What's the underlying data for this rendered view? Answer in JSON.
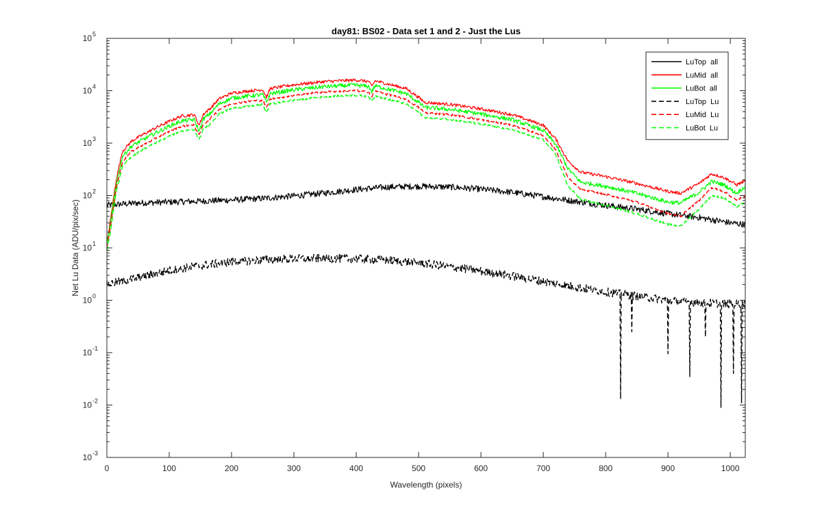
{
  "chart_data": {
    "type": "line",
    "title": "day81: BS02 - Data set 1 and 2 - Just the Lus",
    "xlabel": "Wavelength (pixels)",
    "ylabel": "Net Lu Data (ADU/pix/sec)",
    "xlim": [
      0,
      1024
    ],
    "ylim": [
      0.001,
      100000
    ],
    "yscale": "log",
    "x_ticks": [
      0,
      100,
      200,
      300,
      400,
      500,
      600,
      700,
      800,
      900,
      1000
    ],
    "y_ticks": [
      {
        "value": 0.001,
        "base": "10",
        "exp": "-3"
      },
      {
        "value": 0.01,
        "base": "10",
        "exp": "-2"
      },
      {
        "value": 0.1,
        "base": "10",
        "exp": "-1"
      },
      {
        "value": 1,
        "base": "10",
        "exp": "0"
      },
      {
        "value": 10,
        "base": "10",
        "exp": "1"
      },
      {
        "value": 100,
        "base": "10",
        "exp": "2"
      },
      {
        "value": 1000,
        "base": "10",
        "exp": "3"
      },
      {
        "value": 10000,
        "base": "10",
        "exp": "4"
      },
      {
        "value": 100000,
        "base": "10",
        "exp": "5"
      }
    ],
    "grid": false,
    "legend_position": "top-right",
    "series": [
      {
        "name": "LuTop  all",
        "color": "#000000",
        "dash": "solid",
        "noise": 0.06,
        "x": [
          0,
          20,
          50,
          100,
          150,
          200,
          250,
          300,
          350,
          400,
          450,
          500,
          550,
          600,
          650,
          700,
          750,
          800,
          850,
          900,
          950,
          1000,
          1024
        ],
        "y": [
          65,
          68,
          72,
          75,
          78,
          82,
          88,
          98,
          112,
          130,
          145,
          150,
          145,
          132,
          115,
          95,
          78,
          65,
          55,
          45,
          38,
          30,
          28
        ]
      },
      {
        "name": "LuMid  all",
        "color": "#ff0000",
        "dash": "solid",
        "noise": 0.03,
        "x": [
          0,
          5,
          15,
          25,
          40,
          60,
          80,
          100,
          120,
          140,
          148,
          155,
          165,
          180,
          200,
          230,
          250,
          256,
          262,
          300,
          350,
          400,
          420,
          425,
          430,
          480,
          500,
          510,
          550,
          600,
          650,
          700,
          720,
          740,
          760,
          800,
          850,
          900,
          920,
          950,
          970,
          990,
          1010,
          1024
        ],
        "y": [
          12,
          30,
          200,
          700,
          1100,
          1500,
          2000,
          2600,
          3300,
          3500,
          2200,
          3600,
          4500,
          7000,
          9000,
          10000,
          10500,
          7500,
          11000,
          13000,
          15000,
          16000,
          15000,
          12000,
          15500,
          11000,
          7500,
          6000,
          5500,
          4500,
          3500,
          2200,
          1200,
          450,
          280,
          230,
          170,
          120,
          110,
          170,
          260,
          220,
          160,
          190
        ]
      },
      {
        "name": "LuBot  all",
        "color": "#00ff00",
        "dash": "solid",
        "noise": 0.04,
        "x": [
          0,
          5,
          15,
          25,
          40,
          60,
          80,
          100,
          120,
          140,
          148,
          155,
          165,
          180,
          200,
          230,
          250,
          256,
          262,
          300,
          350,
          400,
          420,
          425,
          430,
          480,
          500,
          510,
          550,
          600,
          650,
          700,
          720,
          740,
          760,
          800,
          850,
          900,
          920,
          950,
          970,
          990,
          1010,
          1024
        ],
        "y": [
          11,
          25,
          170,
          560,
          880,
          1200,
          1600,
          2100,
          2650,
          2800,
          1700,
          2900,
          3600,
          5600,
          7200,
          8000,
          8400,
          6000,
          8800,
          10400,
          12000,
          12800,
          12000,
          9600,
          12400,
          8800,
          6000,
          4800,
          4400,
          3600,
          2800,
          1750,
          950,
          320,
          180,
          150,
          110,
          75,
          72,
          115,
          185,
          160,
          110,
          150
        ]
      },
      {
        "name": "LuTop  Lu",
        "color": "#000000",
        "dash": "dashed",
        "noise": 0.08,
        "x": [
          0,
          50,
          100,
          150,
          200,
          250,
          300,
          350,
          400,
          450,
          500,
          550,
          600,
          650,
          700,
          750,
          800,
          850,
          900,
          950,
          1000,
          1024
        ],
        "y": [
          2.0,
          2.7,
          3.7,
          4.6,
          5.4,
          5.9,
          6.2,
          6.3,
          6.2,
          5.8,
          5.2,
          4.4,
          3.6,
          2.9,
          2.3,
          1.8,
          1.45,
          1.2,
          1.0,
          0.9,
          0.85,
          0.85
        ],
        "dips": [
          [
            824,
            0.013
          ],
          [
            842,
            0.25
          ],
          [
            900,
            0.095
          ],
          [
            935,
            0.035
          ],
          [
            960,
            0.2
          ],
          [
            985,
            0.009
          ],
          [
            1005,
            0.04
          ],
          [
            1018,
            0.011
          ]
        ]
      },
      {
        "name": "LuMid  Lu",
        "color": "#ff0000",
        "dash": "dashed",
        "noise": 0.02,
        "x": [
          0,
          5,
          15,
          25,
          40,
          60,
          80,
          100,
          120,
          140,
          148,
          155,
          165,
          180,
          200,
          230,
          250,
          256,
          262,
          300,
          350,
          400,
          420,
          425,
          430,
          480,
          500,
          510,
          550,
          600,
          650,
          700,
          720,
          740,
          760,
          800,
          850,
          900,
          920,
          950,
          970,
          990,
          1010,
          1024
        ],
        "y": [
          10,
          22,
          140,
          440,
          700,
          950,
          1260,
          1650,
          2100,
          2200,
          1400,
          2300,
          2850,
          4400,
          5700,
          6300,
          6600,
          4700,
          6900,
          8200,
          9500,
          10000,
          9500,
          7600,
          9800,
          6900,
          4800,
          3800,
          3500,
          2800,
          2200,
          1400,
          750,
          220,
          130,
          105,
          75,
          45,
          40,
          80,
          140,
          120,
          80,
          100
        ]
      },
      {
        "name": "LuBot  Lu",
        "color": "#00ff00",
        "dash": "dashed",
        "noise": 0.02,
        "x": [
          0,
          5,
          15,
          25,
          40,
          60,
          80,
          100,
          120,
          140,
          148,
          155,
          165,
          180,
          200,
          230,
          250,
          256,
          262,
          300,
          350,
          400,
          420,
          425,
          430,
          480,
          500,
          510,
          550,
          600,
          650,
          700,
          720,
          740,
          760,
          800,
          850,
          900,
          920,
          950,
          970,
          990,
          1010,
          1024
        ],
        "y": [
          9,
          18,
          115,
          360,
          560,
          780,
          1030,
          1340,
          1700,
          1800,
          1150,
          1850,
          2300,
          3600,
          4600,
          5100,
          5400,
          3850,
          5600,
          6600,
          7700,
          8200,
          7700,
          6200,
          8000,
          5600,
          3900,
          3100,
          2850,
          2300,
          1800,
          1150,
          600,
          150,
          85,
          65,
          45,
          28,
          26,
          55,
          100,
          90,
          60,
          75
        ]
      }
    ]
  }
}
